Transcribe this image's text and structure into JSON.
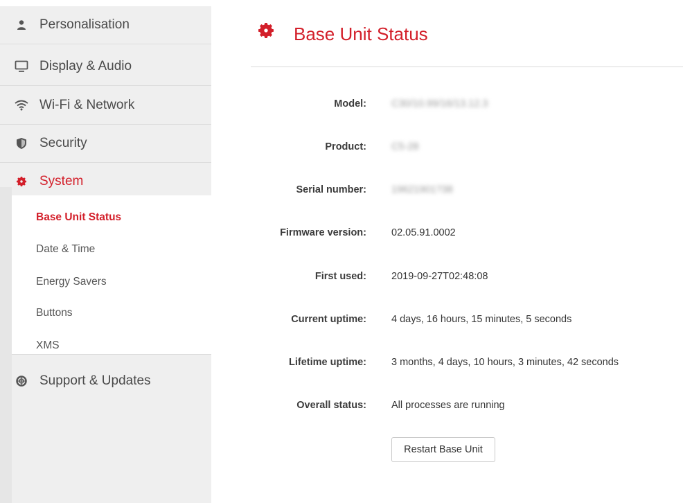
{
  "sidebar": {
    "items": [
      {
        "label": "Personalisation",
        "icon": "person-icon"
      },
      {
        "label": "Display & Audio",
        "icon": "monitor-icon"
      },
      {
        "label": "Wi-Fi & Network",
        "icon": "wifi-icon"
      },
      {
        "label": "Security",
        "icon": "shield-icon"
      },
      {
        "label": "System",
        "icon": "gear-icon"
      },
      {
        "label": "Support & Updates",
        "icon": "lifebuoy-icon"
      }
    ],
    "sub_items": [
      {
        "label": "Base Unit Status"
      },
      {
        "label": "Date & Time"
      },
      {
        "label": "Energy Savers"
      },
      {
        "label": "Buttons"
      },
      {
        "label": "XMS"
      }
    ]
  },
  "header": {
    "title": "Base Unit Status",
    "icon": "gear-icon"
  },
  "status": [
    {
      "key": "Model:",
      "value": "C30/10.99/16/13.12.3"
    },
    {
      "key": "Product:",
      "value": "C5-28"
    },
    {
      "key": "Serial number:",
      "value": "19621901?38"
    },
    {
      "key": "Firmware version:",
      "value": "02.05.91.0002"
    },
    {
      "key": "First used:",
      "value": "2019-09-27T02:48:08"
    },
    {
      "key": "Current uptime:",
      "value": "4 days, 16 hours, 15 minutes, 5 seconds"
    },
    {
      "key": "Lifetime uptime:",
      "value": "3 months, 4 days, 10 hours, 3 minutes, 42 seconds"
    },
    {
      "key": "Overall status:",
      "value": "All processes are running"
    }
  ],
  "restart_label": "Restart Base Unit",
  "colors": {
    "accent": "#d31f2a",
    "sidebar_bg": "#efefef"
  }
}
